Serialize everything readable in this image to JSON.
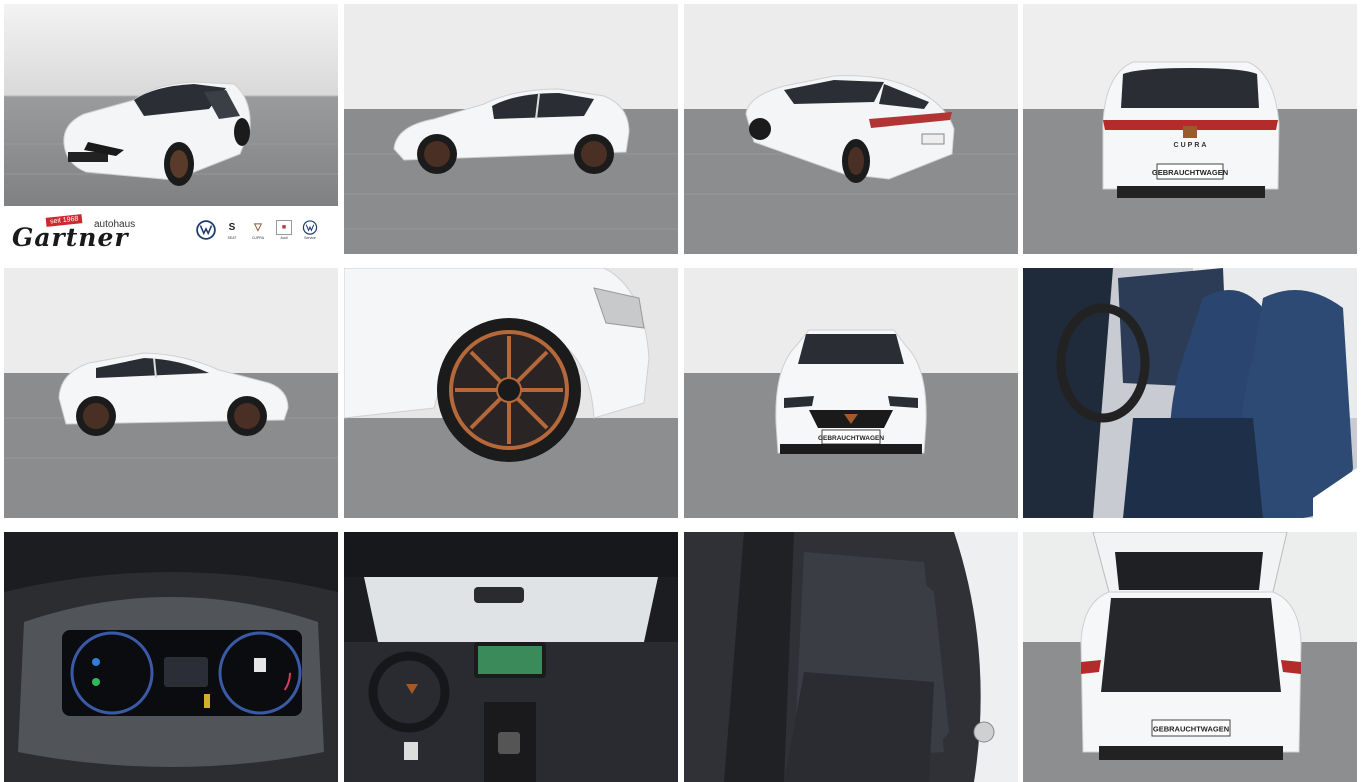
{
  "gallery": {
    "photos": [
      {
        "name": "photo-front-three-quarter"
      },
      {
        "name": "photo-side-left"
      },
      {
        "name": "photo-rear-three-quarter"
      },
      {
        "name": "photo-rear"
      },
      {
        "name": "photo-side-right"
      },
      {
        "name": "photo-wheel"
      },
      {
        "name": "photo-front"
      },
      {
        "name": "photo-front-seats"
      },
      {
        "name": "photo-instrument-cluster"
      },
      {
        "name": "photo-dashboard"
      },
      {
        "name": "photo-rear-seats"
      },
      {
        "name": "photo-trunk"
      }
    ]
  },
  "dealer": {
    "since_badge": "seit 1968",
    "autohaus_label": "autohaus",
    "name": "Gartner",
    "brands": [
      {
        "icon": "vw-logo-icon",
        "text": "",
        "sub": ""
      },
      {
        "icon": "seat-logo-icon",
        "text": "S",
        "sub": "SEAT"
      },
      {
        "icon": "cupra-logo-icon",
        "text": "▽",
        "sub": "CUPRA"
      },
      {
        "icon": "skoda-logo-icon",
        "text": "■",
        "sub": "Audi"
      },
      {
        "icon": "vw-service-logo-icon",
        "text": "",
        "sub": "Service"
      }
    ]
  },
  "plates": {
    "rear": "GEBRAUCHTWAGEN",
    "front": "GEBRAUCHTWAGEN",
    "trunk": "GEBRAUCHTWAGEN",
    "rear_badge": "CUPRA"
  },
  "colors": {
    "car_white": "#f4f5f6",
    "floor": "#8d8f91",
    "sky": "#e9eaeb",
    "copper": "#b5683a",
    "cupra_copper": "#a35a2a",
    "interior_blue": "#2a4670"
  }
}
